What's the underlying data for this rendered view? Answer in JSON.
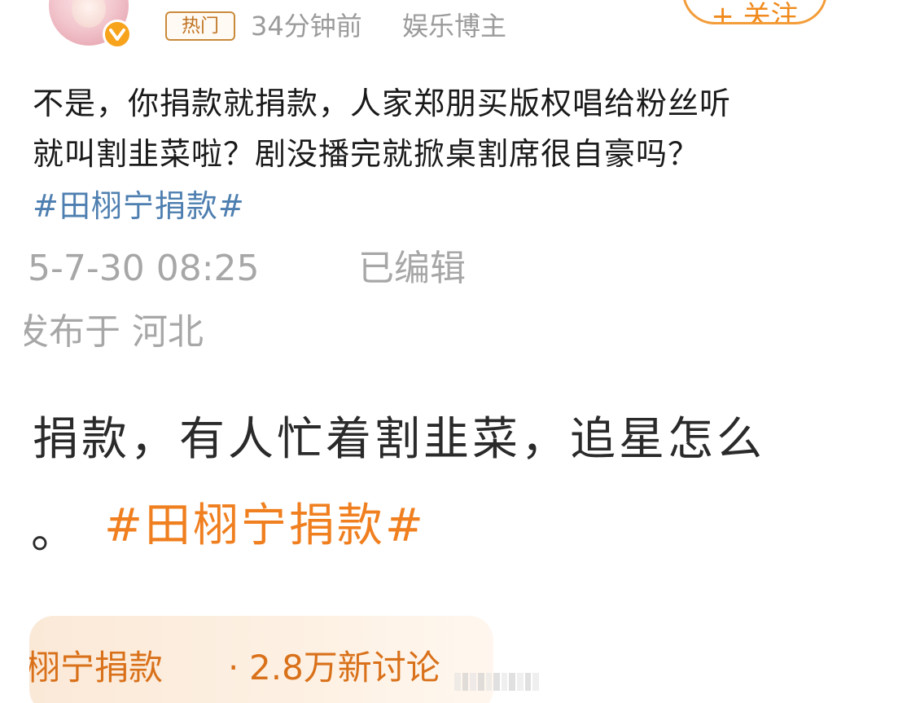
{
  "header": {
    "hot_tag": "热门",
    "time_ago": "34分钟前",
    "role": "娱乐博主",
    "follow_label": "+ 关注"
  },
  "post": {
    "line1": "不是，你捐款就捐款，人家郑朋买版权唱给粉丝听",
    "line2": "就叫割韭菜啦？剧没播完就掀桌割席很自豪吗？",
    "hashtag": "#田栩宁捐款#",
    "date": "5-7-30 08:25",
    "edited": "已编辑",
    "location": "发布于 河北"
  },
  "quote": {
    "line1": "捐款，有人忙着割韭菜，追星怎么",
    "period": "。",
    "hashtag": "#田栩宁捐款#"
  },
  "topic_card": {
    "name": "栩宁捐款",
    "separator": "·",
    "discussion_count": "2.8万新讨论"
  },
  "colors": {
    "accent_orange": "#f07f1f",
    "link_blue": "#4e7fb0",
    "meta_gray": "#9b9b9b",
    "verified_gold": "#f7a31c"
  }
}
